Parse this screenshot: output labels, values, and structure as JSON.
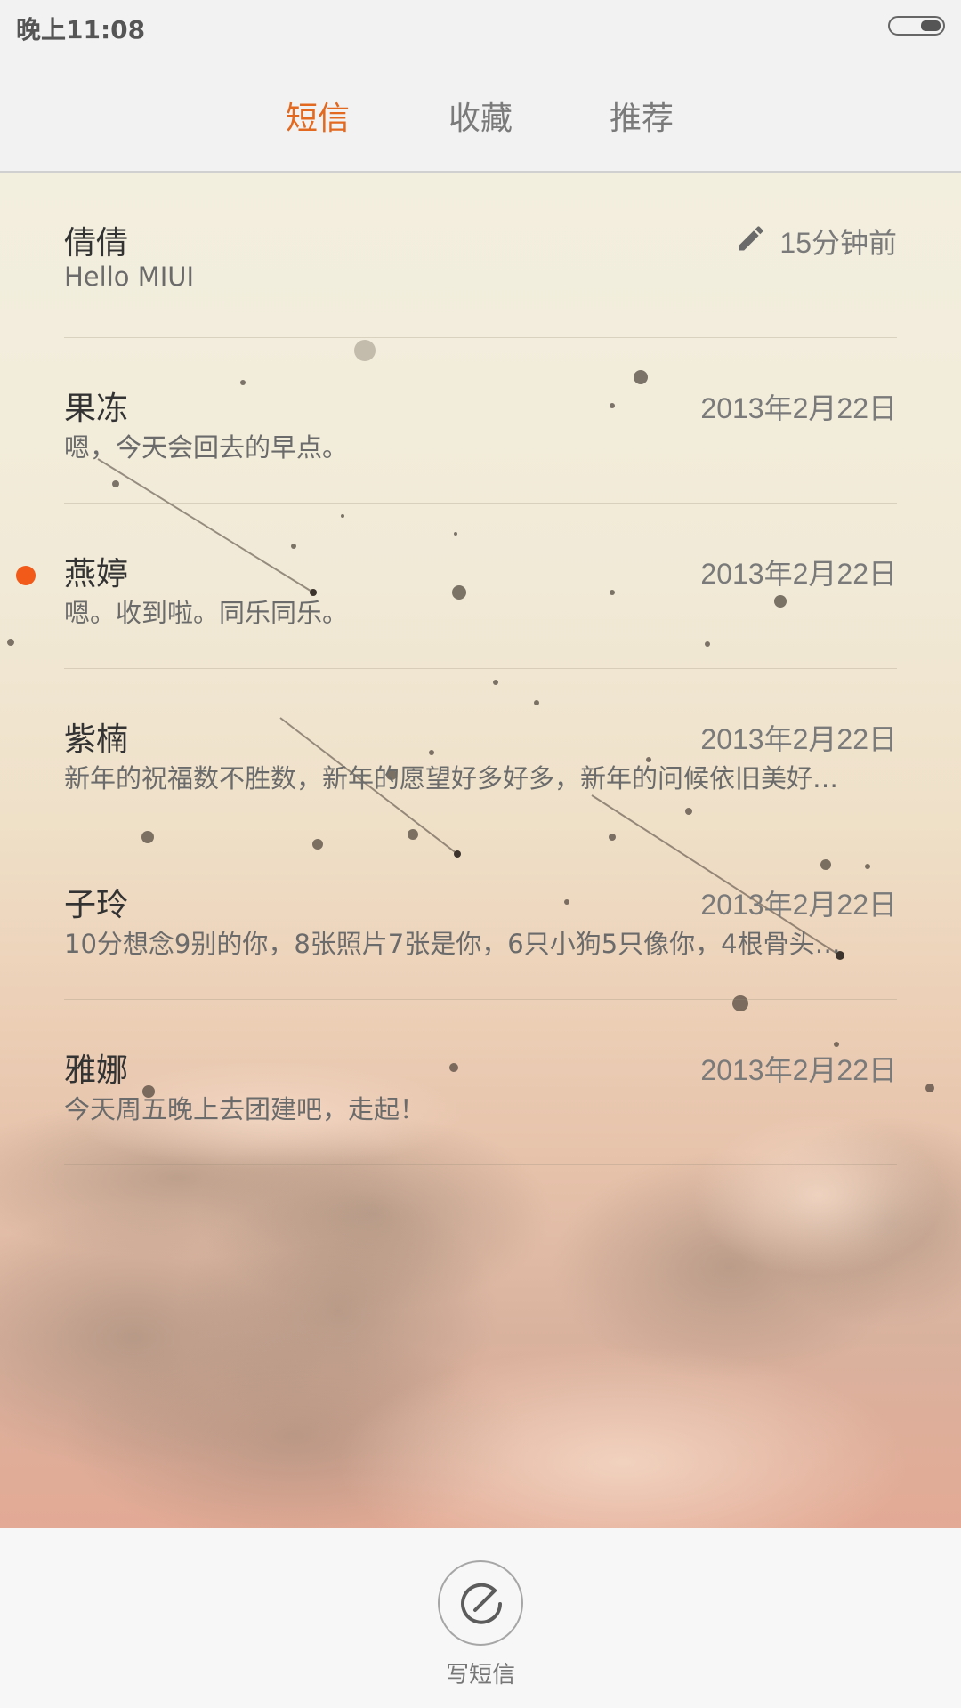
{
  "status_bar": {
    "time": "晚上11:08"
  },
  "tabs": [
    {
      "label": "短信",
      "active": true
    },
    {
      "label": "收藏",
      "active": false
    },
    {
      "label": "推荐",
      "active": false
    }
  ],
  "conversations": [
    {
      "name": "倩倩",
      "preview": "Hello MIUI",
      "time": "15分钟前",
      "draft": true,
      "unread": false
    },
    {
      "name": "果冻",
      "preview": "嗯，今天会回去的早点。",
      "time": "2013年2月22日",
      "draft": false,
      "unread": false
    },
    {
      "name": "燕婷",
      "preview": "嗯。收到啦。同乐同乐。",
      "time": "2013年2月22日",
      "draft": false,
      "unread": true
    },
    {
      "name": "紫楠",
      "preview": "新年的祝福数不胜数，新年的愿望好多好多，新年的问候依旧美好…",
      "time": "2013年2月22日",
      "draft": false,
      "unread": false
    },
    {
      "name": "子玲",
      "preview": "10分想念9别的你，8张照片7张是你，6只小狗5只像你，4根骨头…",
      "time": "2013年2月22日",
      "draft": false,
      "unread": false
    },
    {
      "name": "雅娜",
      "preview": "今天周五晚上去团建吧，走起！",
      "time": "2013年2月22日",
      "draft": false,
      "unread": false
    }
  ],
  "compose": {
    "label": "写短信",
    "icon": "compose-icon"
  },
  "colors": {
    "accent": "#e2691f",
    "unread_dot": "#f25a1a"
  }
}
